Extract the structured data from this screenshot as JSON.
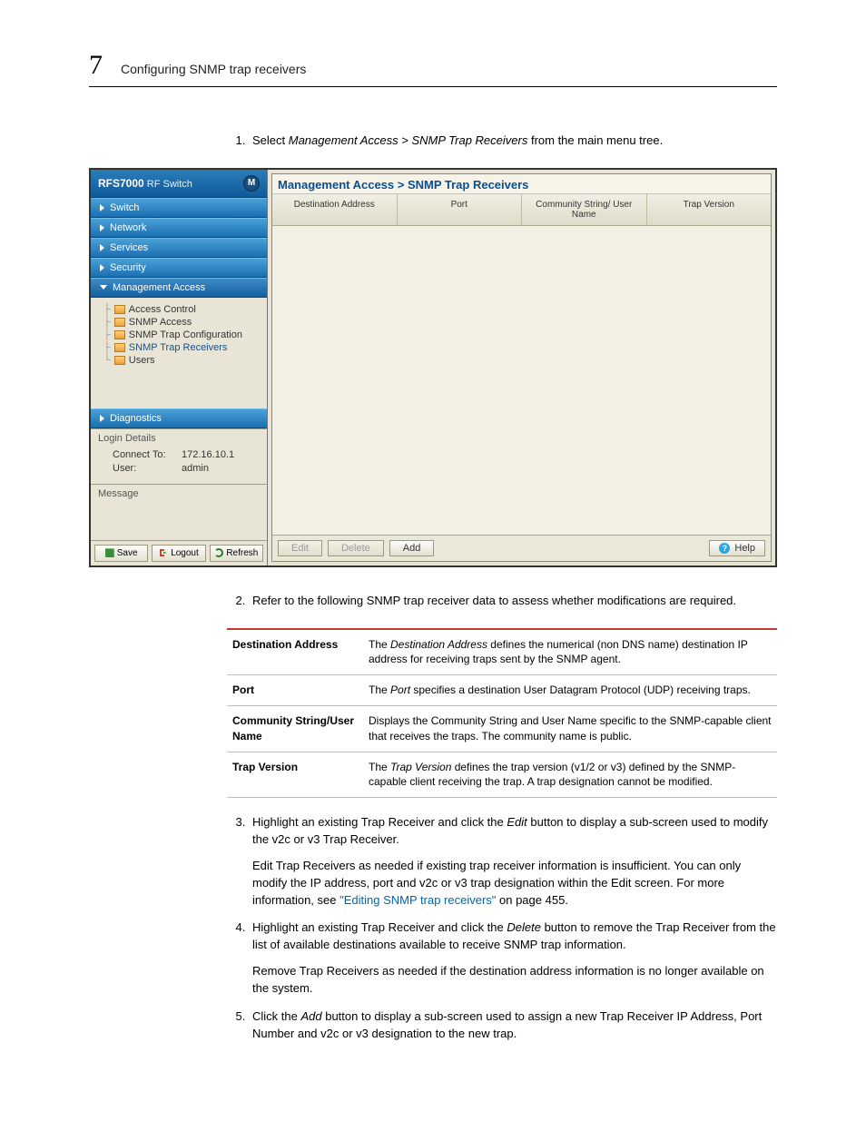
{
  "header": {
    "chapter_number": "7",
    "chapter_title": "Configuring SNMP trap receivers"
  },
  "steps": [
    {
      "num": "1.",
      "html": "Select <em>Management Access > SNMP Trap Receivers</em> from the main menu tree."
    },
    {
      "num": "2.",
      "html": "Refer to the following SNMP trap receiver data to assess whether modifications are required."
    },
    {
      "num": "3.",
      "html": "Highlight an existing Trap Receiver and click the <em>Edit</em> button to display a sub-screen used to modify the v2c or v3 Trap Receiver.",
      "para": "Edit Trap Receivers as needed if existing trap receiver information is insufficient. You can only modify the IP address, port and v2c or v3 trap designation within the Edit screen. For more information, see <a class=\"link\" href=\"#\" data-interactable=\"true\" data-name=\"xref-editing-snmp-trap-receivers\">\"Editing SNMP trap receivers\"</a> on page 455."
    },
    {
      "num": "4.",
      "html": "Highlight an existing Trap Receiver and click the <em>Delete</em> button to remove the Trap Receiver from the list of available destinations available to receive SNMP trap information.",
      "para": "Remove Trap Receivers as needed if the destination address information is no longer available on the system."
    },
    {
      "num": "5.",
      "html": "Click the <em>Add</em> button to display a sub-screen used to assign a new Trap Receiver IP Address, Port Number and v2c or v3 designation to the new trap."
    }
  ],
  "defs": [
    {
      "term": "Destination Address",
      "desc": "The <em>Destination Address</em> defines the numerical (non DNS name) destination IP address for receiving traps sent by the SNMP agent."
    },
    {
      "term": "Port",
      "desc": "The <em>Port</em> specifies a destination User Datagram Protocol (UDP) receiving traps."
    },
    {
      "term": "Community String/User Name",
      "desc": "Displays the Community String and User Name specific to the SNMP-capable client that receives the traps. The community name is public."
    },
    {
      "term": "Trap Version",
      "desc": "The <em>Trap Version</em> defines the trap version (v1/2 or v3) defined by the SNMP-capable client receiving the trap. A trap designation cannot be modified."
    }
  ],
  "ui": {
    "brand_product": "RFS7000",
    "brand_sub": "RF Switch",
    "brand_logo_letter": "M",
    "nav": {
      "switch": "Switch",
      "network": "Network",
      "services": "Services",
      "security": "Security",
      "mgmt": "Management Access",
      "diag": "Diagnostics"
    },
    "tree": {
      "access_control": "Access Control",
      "snmp_access": "SNMP Access",
      "snmp_trap_cfg": "SNMP Trap Configuration",
      "snmp_trap_recv": "SNMP Trap Receivers",
      "users": "Users"
    },
    "login": {
      "legend": "Login Details",
      "connect_label": "Connect To:",
      "connect_value": "172.16.10.1",
      "user_label": "User:",
      "user_value": "admin"
    },
    "message_legend": "Message",
    "left_buttons": {
      "save": "Save",
      "logout": "Logout",
      "refresh": "Refresh"
    },
    "breadcrumb": "Management Access > SNMP Trap Receivers",
    "columns": {
      "dest": "Destination Address",
      "port": "Port",
      "comm": "Community String/ User Name",
      "ver": "Trap Version"
    },
    "buttons": {
      "edit": "Edit",
      "delete": "Delete",
      "add": "Add",
      "help": "Help"
    }
  }
}
